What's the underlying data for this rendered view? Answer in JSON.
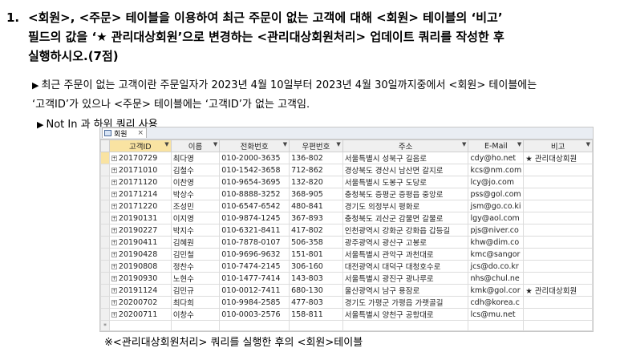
{
  "question": {
    "number": "1.",
    "lines": [
      "<회원>, <주문> 테이블을 이용하여 최근 주문이 없는 고객에 대해 <회원> 테이블의 ‘비고’",
      "필드의 값을 ‘★ 관리대상회원’으로 변경하는 <관리대상회원처리> 업데이트 쿼리를 작성한 후",
      "실행하시오.(7점)"
    ]
  },
  "notes": {
    "bullet_char": "▶",
    "note1_line1": "최근 주문이 없는 고객이란 주문일자가 2023년 4월 10일부터 2023년 4월 30일까지중에서 <회원> 테이블에는",
    "note1_line2": "‘고객ID’가 있으나 <주문> 테이블에는 ‘고객ID’가 없는 고객임.",
    "note2": "Not In 과 하위 쿼리 사용"
  },
  "window": {
    "tab_label": "회원",
    "tab_close": "×",
    "columns": [
      "고객ID",
      "이름",
      "전화번호",
      "우편번호",
      "주소",
      "E-Mail",
      "비고"
    ],
    "rows": [
      [
        "20170729",
        "최다영",
        "010-2000-3635",
        "136-802",
        "서울특별시 성북구 길음로",
        "cdy@ho.net",
        "★ 관리대상회원"
      ],
      [
        "20171010",
        "김철수",
        "010-1542-3658",
        "712-862",
        "경상북도 경산시 남산면 갈지로",
        "kcs@nm.com",
        ""
      ],
      [
        "20171120",
        "이찬영",
        "010-9654-3695",
        "132-820",
        "서울특별시 도봉구 도당로",
        "lcy@jo.com",
        ""
      ],
      [
        "20171214",
        "박상수",
        "010-8888-3252",
        "368-905",
        "충청북도 증평군 증평읍 중앙로",
        "pss@gol.com",
        ""
      ],
      [
        "20171220",
        "조성민",
        "010-6547-6542",
        "480-841",
        "경기도 의정부시 평화로",
        "jsm@go.co.ki",
        ""
      ],
      [
        "20190131",
        "이지영",
        "010-9874-1245",
        "367-893",
        "충청북도 괴산군 감물면 갈물로",
        "lgy@aol.com",
        ""
      ],
      [
        "20190227",
        "박지수",
        "010-6321-8411",
        "417-802",
        "인천광역시 강화군 강화읍 갑등길",
        "pjs@niver.co",
        ""
      ],
      [
        "20190411",
        "김혜원",
        "010-7878-0107",
        "506-358",
        "광주광역시 광산구 고봉로",
        "khw@dim.co",
        ""
      ],
      [
        "20190428",
        "김민철",
        "010-9696-9632",
        "151-801",
        "서울특별시 관악구 과천대로",
        "kmc@sangor",
        ""
      ],
      [
        "20190808",
        "정찬수",
        "010-7474-2145",
        "306-160",
        "대전광역시 대덕구 대청호수로",
        "jcs@do.co.kr",
        ""
      ],
      [
        "20190930",
        "노현수",
        "010-1477-7414",
        "143-803",
        "서울특별시 광진구 광나루로",
        "nhs@chul.ne",
        ""
      ],
      [
        "20191124",
        "김민규",
        "010-0012-7411",
        "680-130",
        "울산광역시 남구 용잠로",
        "kmk@gol.cor",
        "★ 관리대상회원"
      ],
      [
        "20200702",
        "최다희",
        "010-9984-2585",
        "477-803",
        "경기도 가평군 가평읍 가랫골길",
        "cdh@korea.c",
        ""
      ],
      [
        "20200711",
        "이창수",
        "010-0003-2576",
        "158-811",
        "서울특별시 양천구 공항대로",
        "lcs@mu.net",
        ""
      ]
    ],
    "new_row_marker": "*",
    "expand_marker": "+"
  },
  "caption": "※<관리대상회원처리> 쿼리를 실행한 후의 <회원>테이블",
  "colors": {
    "selected_header": "#f9e3a2",
    "grid_border": "#dcdcdc"
  }
}
